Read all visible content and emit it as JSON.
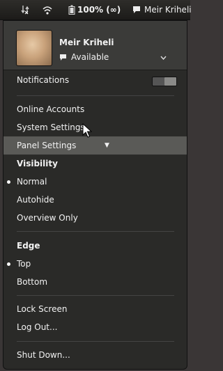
{
  "panel": {
    "battery_label": "100% (∞)",
    "user_label": "Meir Kriheli",
    "icons": [
      "network-icon",
      "wifi-icon",
      "battery-icon",
      "chat-icon"
    ]
  },
  "menu": {
    "header": {
      "name": "Meir Kriheli",
      "status": "Available"
    },
    "notifications_label": "Notifications",
    "notifications_on": true,
    "items": {
      "online_accounts": "Online Accounts",
      "system_settings": "System Settings",
      "panel_settings": "Panel Settings",
      "visibility": "Visibility",
      "normal": "Normal",
      "autohide": "Autohide",
      "overview_only": "Overview Only",
      "edge": "Edge",
      "top": "Top",
      "bottom": "Bottom",
      "lock_screen": "Lock Screen",
      "log_out": "Log Out...",
      "shut_down": "Shut Down..."
    },
    "selected_visibility": "Normal",
    "selected_edge": "Top"
  }
}
